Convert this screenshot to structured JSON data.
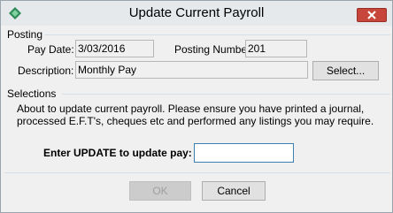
{
  "window": {
    "title": "Update Current Payroll"
  },
  "posting": {
    "group_label": "Posting",
    "pay_date_label": "Pay Date:",
    "pay_date_value": "3/03/2016",
    "posting_number_label": "Posting Number:",
    "posting_number_value": "201",
    "description_label": "Description:",
    "description_value": "Monthly Pay",
    "select_button": "Select..."
  },
  "selections": {
    "group_label": "Selections",
    "message_line1": "About to update current payroll.  Please ensure you have printed a journal,",
    "message_line2": "processed E.F.T's, cheques etc and performed any listings you may require.",
    "prompt_label": "Enter UPDATE to update  pay:",
    "prompt_value": ""
  },
  "buttons": {
    "ok": "OK",
    "cancel": "Cancel"
  },
  "colors": {
    "close_button": "#c7463b",
    "input_focus_border": "#3c7fb1",
    "dialog_background": "#f0f0f0"
  }
}
